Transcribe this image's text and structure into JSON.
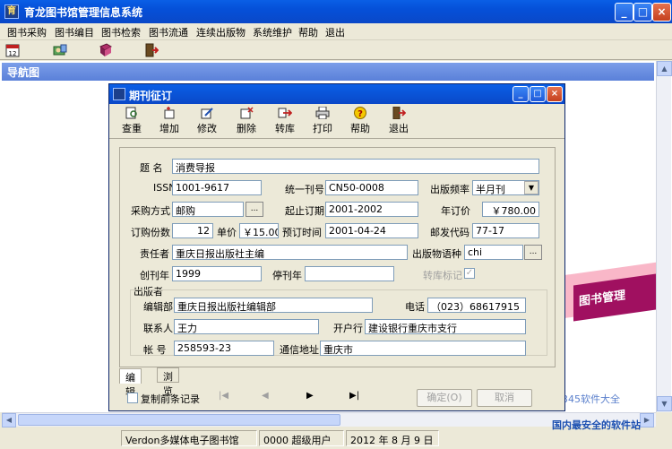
{
  "window": {
    "title": "育龙图书馆管理信息系统"
  },
  "menu": [
    "图书采购",
    "图书编目",
    "图书检索",
    "图书流通",
    "连续出版物",
    "系统维护",
    "帮助",
    "退出"
  ],
  "toolbar_icons": [
    "calendar-icon",
    "users-icon",
    "book-icon",
    "exit-icon"
  ],
  "nav_title": "导航图",
  "dialog": {
    "title": "期刊征订",
    "tools": [
      {
        "label": "查重",
        "icon": "dedupe-icon"
      },
      {
        "label": "增加",
        "icon": "add-icon"
      },
      {
        "label": "修改",
        "icon": "edit-icon"
      },
      {
        "label": "删除",
        "icon": "delete-icon"
      },
      {
        "label": "转库",
        "icon": "transfer-icon"
      },
      {
        "label": "打印",
        "icon": "print-icon"
      },
      {
        "label": "帮助",
        "icon": "help-icon"
      },
      {
        "label": "退出",
        "icon": "exit-icon"
      }
    ],
    "form": {
      "title_label": "题  名",
      "title_value": "消费导报",
      "issn_label": "ISSN",
      "issn_value": "1001-9617",
      "cn_label": "统一刊号",
      "cn_value": "CN50-0008",
      "freq_label": "出版频率",
      "freq_value": "半月刊",
      "purchase_label": "采购方式",
      "purchase_value": "邮购",
      "period_label": "起止订期",
      "period_value": "2001-2002",
      "annual_price_label": "年订价",
      "annual_price_value": "￥780.00",
      "copies_label": "订购份数",
      "copies_value": "12",
      "unit_price_label": "单价",
      "unit_price_value": "￥15.00",
      "order_time_label": "预订时间",
      "order_time_value": "2001-04-24",
      "postal_code_label": "邮发代码",
      "postal_code_value": "77-17",
      "editor_label": "责任者",
      "editor_value": "重庆日报出版社主编",
      "language_label": "出版物语种",
      "language_value": "chi",
      "founded_label": "创刊年",
      "founded_value": "1999",
      "ceased_label": "停刊年",
      "ceased_value": "",
      "transfer_flag_label": "转库标记",
      "publisher_group": "出版者",
      "dept_label": "编辑部",
      "dept_value": "重庆日报出版社编辑部",
      "phone_label": "电话",
      "phone_value": "（023）68617915",
      "contact_label": "联系人",
      "contact_value": "王力",
      "bank_label": "开户行",
      "bank_value": "建设银行重庆市支行",
      "account_label": "帐  号",
      "account_value": "258593-23",
      "address_label": "通信地址",
      "address_value": "重庆市"
    },
    "tabs": [
      "编辑",
      "浏览"
    ],
    "copy_prev_label": "复制前条记录",
    "nav_buttons": [
      "|◀",
      "◀",
      "▶",
      "▶|"
    ],
    "ok_label": "确定(O)",
    "cancel_label": "取消"
  },
  "status": [
    "Verdon多媒体电子图书馆",
    "0000 超级用户",
    "2012 年 8 月 9 日"
  ],
  "watermark": {
    "logo": "图书管理",
    "site": "2345软件大全",
    "tagline": "国内最安全的软件站"
  },
  "colors": {
    "titlebar": "#0a5fe6",
    "nav": "#6b8fe3",
    "face": "#ece9d8"
  }
}
